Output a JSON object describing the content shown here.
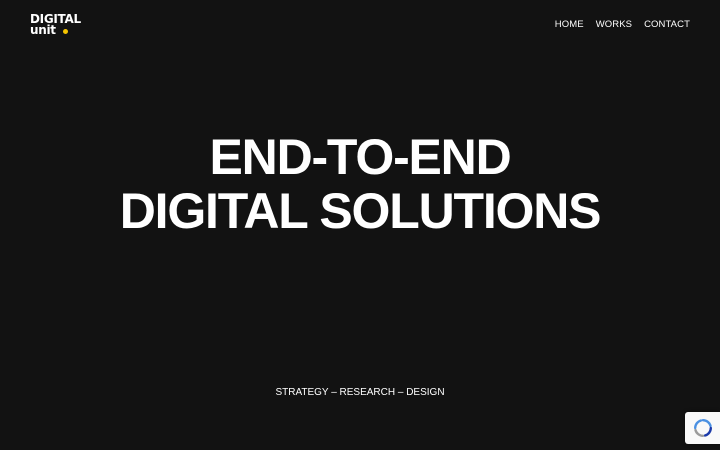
{
  "brand": {
    "line1": "DIGITAL",
    "line2": "unit",
    "dot_color": "#f5c400"
  },
  "nav": {
    "items": [
      {
        "label": "HOME"
      },
      {
        "label": "WORKS"
      },
      {
        "label": "CONTACT"
      }
    ]
  },
  "hero": {
    "line1": "END-TO-END",
    "line2": "DIGITAL SOLUTIONS"
  },
  "tagline": "STRATEGY – RESEARCH – DESIGN",
  "theme": {
    "background": "#121212",
    "text": "#ffffff",
    "accent": "#f5c400"
  },
  "widgets": {
    "recaptcha_icon": "recaptcha-icon"
  }
}
